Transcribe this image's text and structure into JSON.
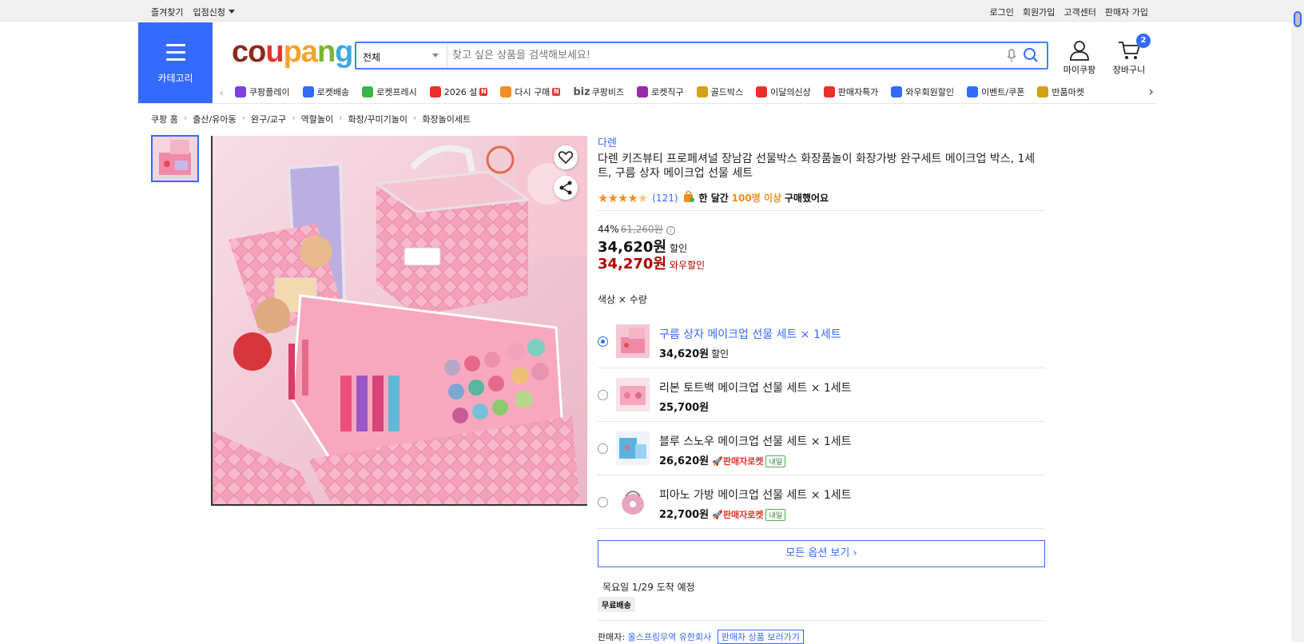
{
  "topbar": {
    "bookmark": "즐겨찾기",
    "store_apply": "입점신청",
    "login": "로그인",
    "signup": "회원가입",
    "customer_center": "고객센터",
    "seller_signup": "판매자 가입"
  },
  "header": {
    "category_label": "카테고리",
    "logo": [
      "c",
      "o",
      "u",
      "p",
      "a",
      "n",
      "g"
    ],
    "search_category": "전체",
    "search_placeholder": "찾고 싶은 상품을 검색해보세요!",
    "mycoupang": "마이쿠팡",
    "cart": "장바구니",
    "cart_count": "2"
  },
  "nav_items": [
    {
      "label": "쿠팡플레이",
      "icon": "play-icon",
      "color": "#7b3fe4"
    },
    {
      "label": "로켓배송",
      "icon": "rocket-icon",
      "color": "#346aff"
    },
    {
      "label": "로켓프레시",
      "icon": "rocket-fresh-icon",
      "color": "#3bb54a"
    },
    {
      "label": "2026 설",
      "icon": "gift-icon",
      "color": "#e8312a",
      "badge": "N"
    },
    {
      "label": "다시 구매",
      "icon": "rebuy-icon",
      "color": "#f28d22",
      "badge": "N"
    },
    {
      "label": "쿠팡비즈",
      "icon": "biz-icon",
      "color": "#555555",
      "prefix": "biz"
    },
    {
      "label": "로켓직구",
      "icon": "global-icon",
      "color": "#9c27b0"
    },
    {
      "label": "골드박스",
      "icon": "goldbox-icon",
      "color": "#d4a017"
    },
    {
      "label": "이달의신상",
      "icon": "new-icon",
      "color": "#e8312a"
    },
    {
      "label": "판매자특가",
      "icon": "sale-icon",
      "color": "#e8312a"
    },
    {
      "label": "와우회원할인",
      "icon": "wow-icon",
      "color": "#346aff"
    },
    {
      "label": "이벤트/쿠폰",
      "icon": "coupon-icon",
      "color": "#346aff"
    },
    {
      "label": "반품마켓",
      "icon": "return-market-icon",
      "color": "#d4a017"
    }
  ],
  "breadcrumb": [
    "쿠팡 홈",
    "출산/유아동",
    "완구/교구",
    "역할놀이",
    "화장/꾸미기놀이",
    "화장놀이세트"
  ],
  "product": {
    "brand": "다렌",
    "title": "다렌 키즈뷰티 프로페셔널 장남감 선물박스 화장품놀이 화장가방 완구세트 메이크업 박스, 1세트, 구름 상자 메이크업 선물 세트",
    "rating": 4.5,
    "review_count": "(121)",
    "bought_prefix": "한 달간",
    "bought_count": "100명 이상",
    "bought_suffix": "구매했어요",
    "discount_rate": "44%",
    "original_price": "61,260원",
    "sale_price": "34,620원",
    "sale_label": "할인",
    "wow_price": "34,270원",
    "wow_label": "와우할인",
    "option_label": "색상 × 수량",
    "options": [
      {
        "name": "구름 상자 메이크업 선물 세트 × 1세트",
        "price": "34,620원",
        "price_label": "할인",
        "selected": true
      },
      {
        "name": "리본 토트백 메이크업 선물 세트 × 1세트",
        "price": "25,700원"
      },
      {
        "name": "블루 스노우 메이크업 선물 세트 × 1세트",
        "price": "26,620원",
        "rocket": "판매자로켓",
        "eta": "내일"
      },
      {
        "name": "피아노 가방 메이크업 선물 세트 × 1세트",
        "price": "22,700원",
        "rocket": "판매자로켓",
        "eta": "내일"
      }
    ],
    "all_options": "모든 옵션 보기 ›",
    "arrival": "목요일 1/29 도착 예정",
    "free_shipping": "무료배송",
    "seller_label": "판매자:",
    "seller_name": "올스프링무역 유한회사",
    "seller_link": "판매자 상품 보러가기"
  }
}
